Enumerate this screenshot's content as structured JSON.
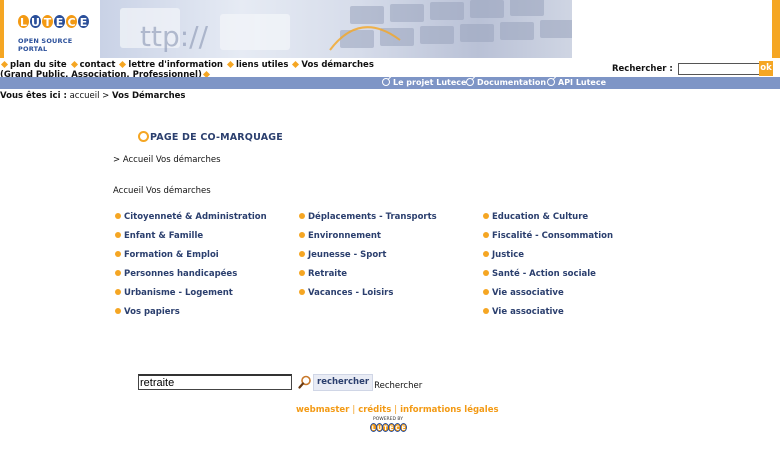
{
  "header": {
    "logo_letters": [
      "L",
      "U",
      "T",
      "E",
      "C",
      "E"
    ],
    "logo_tagline": "OPEN SOURCE PORTAL"
  },
  "topnav": {
    "items": [
      "plan du site",
      "contact",
      "lettre d'information",
      "liens utiles",
      "Vos démarches  (Grand Public, Association, Professionnel)"
    ]
  },
  "search_top": {
    "label": "Rechercher :",
    "value": "",
    "button": "ok"
  },
  "subnav": {
    "items": [
      "Le projet Lutece",
      "Documentation",
      "API Lutece"
    ]
  },
  "breadcrumb": {
    "prefix": "Vous êtes ici :",
    "home": "accueil",
    "separator": ">",
    "current": "Vos Démarches"
  },
  "main": {
    "title": "PAGE DE CO-MARQUAGE",
    "path": "> Accueil Vos démarches",
    "section_label": "Accueil Vos démarches",
    "categories": [
      "Citoyenneté & Administration",
      "Déplacements - Transports",
      "Education & Culture",
      "Enfant & Famille",
      "Environnement",
      "Fiscalité - Consommation",
      "Formation & Emploi",
      "Jeunesse - Sport",
      "Justice",
      "Personnes handicapées",
      "Retraite",
      "Santé - Action sociale",
      "Urbanisme - Logement",
      "Vacances - Loisirs",
      "Vie associative",
      "Vos papiers",
      "Vie associative"
    ]
  },
  "search_form": {
    "value": "retraite",
    "button": "rechercher",
    "label": "Rechercher"
  },
  "footer": {
    "links": [
      "webmaster",
      "crédits",
      "informations légales"
    ],
    "separator": "|",
    "powered_by": "POWERED BY",
    "powered_logo": [
      "L",
      "U",
      "T",
      "E",
      "C",
      "E"
    ]
  },
  "colors": {
    "accent": "#f5a623",
    "nav_blue": "#7e95c6",
    "title_blue": "#2b3f6e"
  }
}
